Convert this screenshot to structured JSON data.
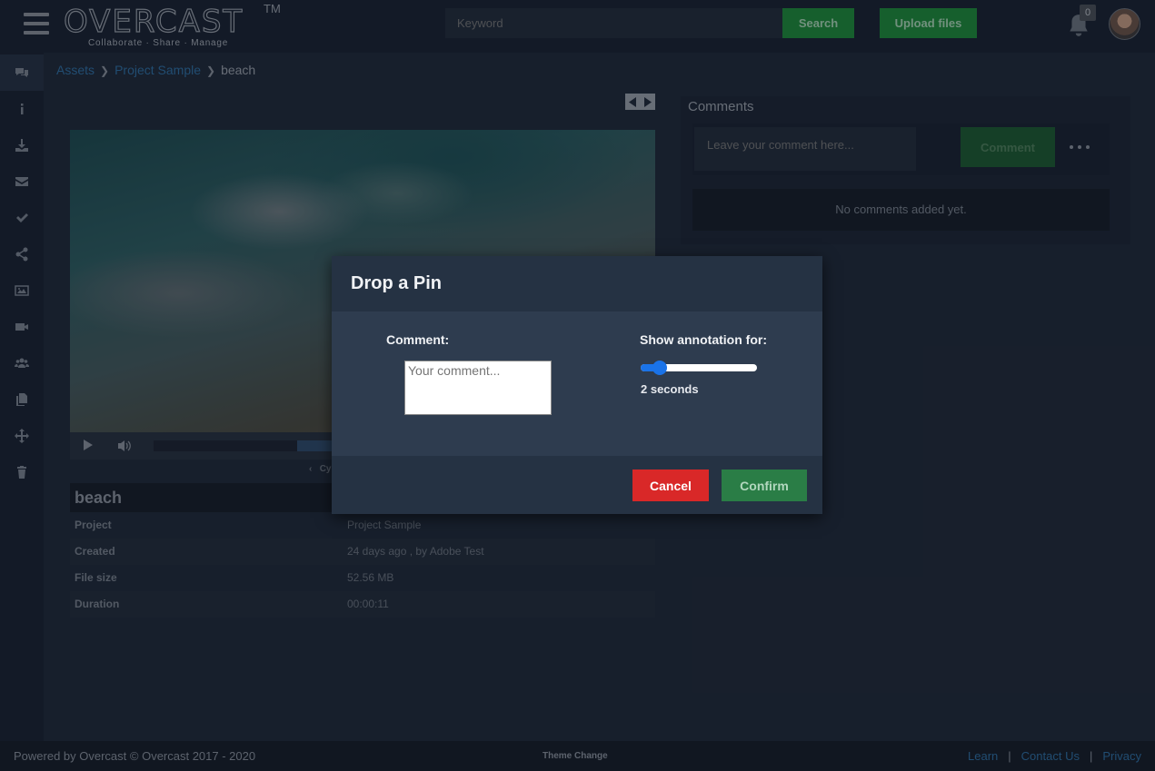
{
  "header": {
    "logo_text": "OVERCAST",
    "logo_tm": "TM",
    "tagline": "Collaborate · Share · Manage",
    "search_placeholder": "Keyword",
    "search_label": "Search",
    "upload_label": "Upload files",
    "notification_count": "0"
  },
  "sidebar": {
    "items": [
      {
        "icon": "comments-icon",
        "active": true
      },
      {
        "icon": "info-icon"
      },
      {
        "icon": "download-icon"
      },
      {
        "icon": "envelope-icon"
      },
      {
        "icon": "check-icon"
      },
      {
        "icon": "share-icon"
      },
      {
        "icon": "image-icon"
      },
      {
        "icon": "video-icon"
      },
      {
        "icon": "users-icon"
      },
      {
        "icon": "copy-icon"
      },
      {
        "icon": "move-icon"
      },
      {
        "icon": "trash-icon"
      }
    ]
  },
  "breadcrumb": {
    "items": [
      "Assets",
      "Project Sample"
    ],
    "current": "beach"
  },
  "video": {
    "caption_partial": "Cy"
  },
  "asset": {
    "title": "beach",
    "rows": [
      {
        "key": "Project",
        "value": "Project Sample"
      },
      {
        "key": "Created",
        "value": "24 days ago , by  Adobe Test"
      },
      {
        "key": "File size",
        "value": "52.56 MB"
      },
      {
        "key": "Duration",
        "value": "00:00:11"
      }
    ]
  },
  "comments": {
    "title": "Comments",
    "input_placeholder": "Leave your comment here...",
    "button_label": "Comment",
    "empty_text": "No comments added yet."
  },
  "modal": {
    "title": "Drop a Pin",
    "comment_label": "Comment:",
    "comment_placeholder": "Your comment...",
    "annotation_label": "Show annotation for:",
    "slider_fraction": 0.12,
    "slider_value_text": "2 seconds",
    "cancel_label": "Cancel",
    "confirm_label": "Confirm"
  },
  "footer": {
    "copyright": "Powered by Overcast  ©  Overcast  2017 - 2020",
    "theme_change": "Theme Change",
    "links": [
      "Learn",
      "Contact Us",
      "Privacy"
    ]
  },
  "colors": {
    "accent_green": "#1e8b3a",
    "link_blue": "#2f6fa3",
    "cancel_red": "#d92828",
    "slider_blue": "#1a73e8"
  }
}
